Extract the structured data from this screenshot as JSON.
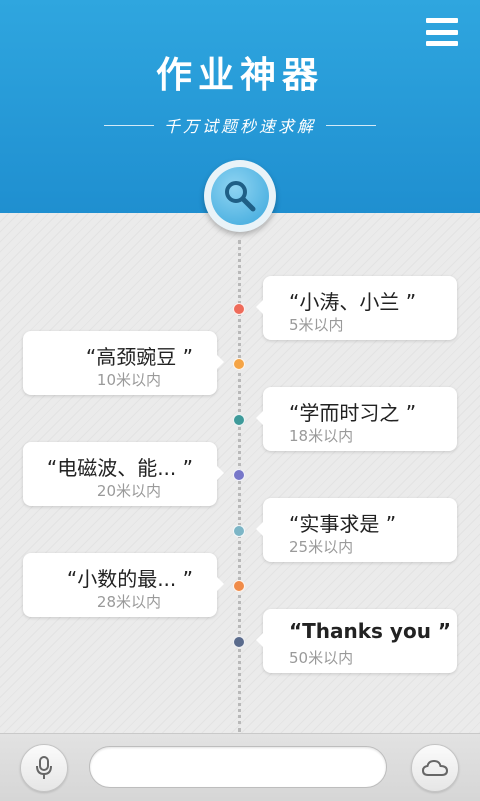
{
  "header": {
    "title": "作业神器",
    "subtitle": "千万试题秒速求解"
  },
  "icons": {
    "menu": "menu-icon",
    "search": "search-icon",
    "mic": "microphone-icon",
    "cloud": "cloud-icon"
  },
  "colors": {
    "header_blue": "#2fa6df",
    "dot_red": "#ee6b5a",
    "dot_orange": "#f5a445",
    "dot_teal": "#3e9a9a",
    "dot_purple": "#7777c9",
    "dot_lightblue": "#7cb5c6",
    "dot_orange2": "#f08b48",
    "dot_navy": "#5a6b8c"
  },
  "timeline": {
    "items": [
      {
        "title": "“小涛、小兰 ”",
        "distance": "5米以内"
      },
      {
        "title": "“高颈豌豆 ”",
        "distance": "10米以内"
      },
      {
        "title": "“学而时习之 ”",
        "distance": "18米以内"
      },
      {
        "title": "“电磁波、能... ”",
        "distance": "20米以内"
      },
      {
        "title": "“实事求是 ”",
        "distance": "25米以内"
      },
      {
        "title": "“小数的最... ”",
        "distance": "28米以内"
      },
      {
        "title": "“Thanks you ”",
        "distance": "50米以内"
      }
    ]
  },
  "bottom": {
    "input_value": "",
    "input_placeholder": ""
  }
}
